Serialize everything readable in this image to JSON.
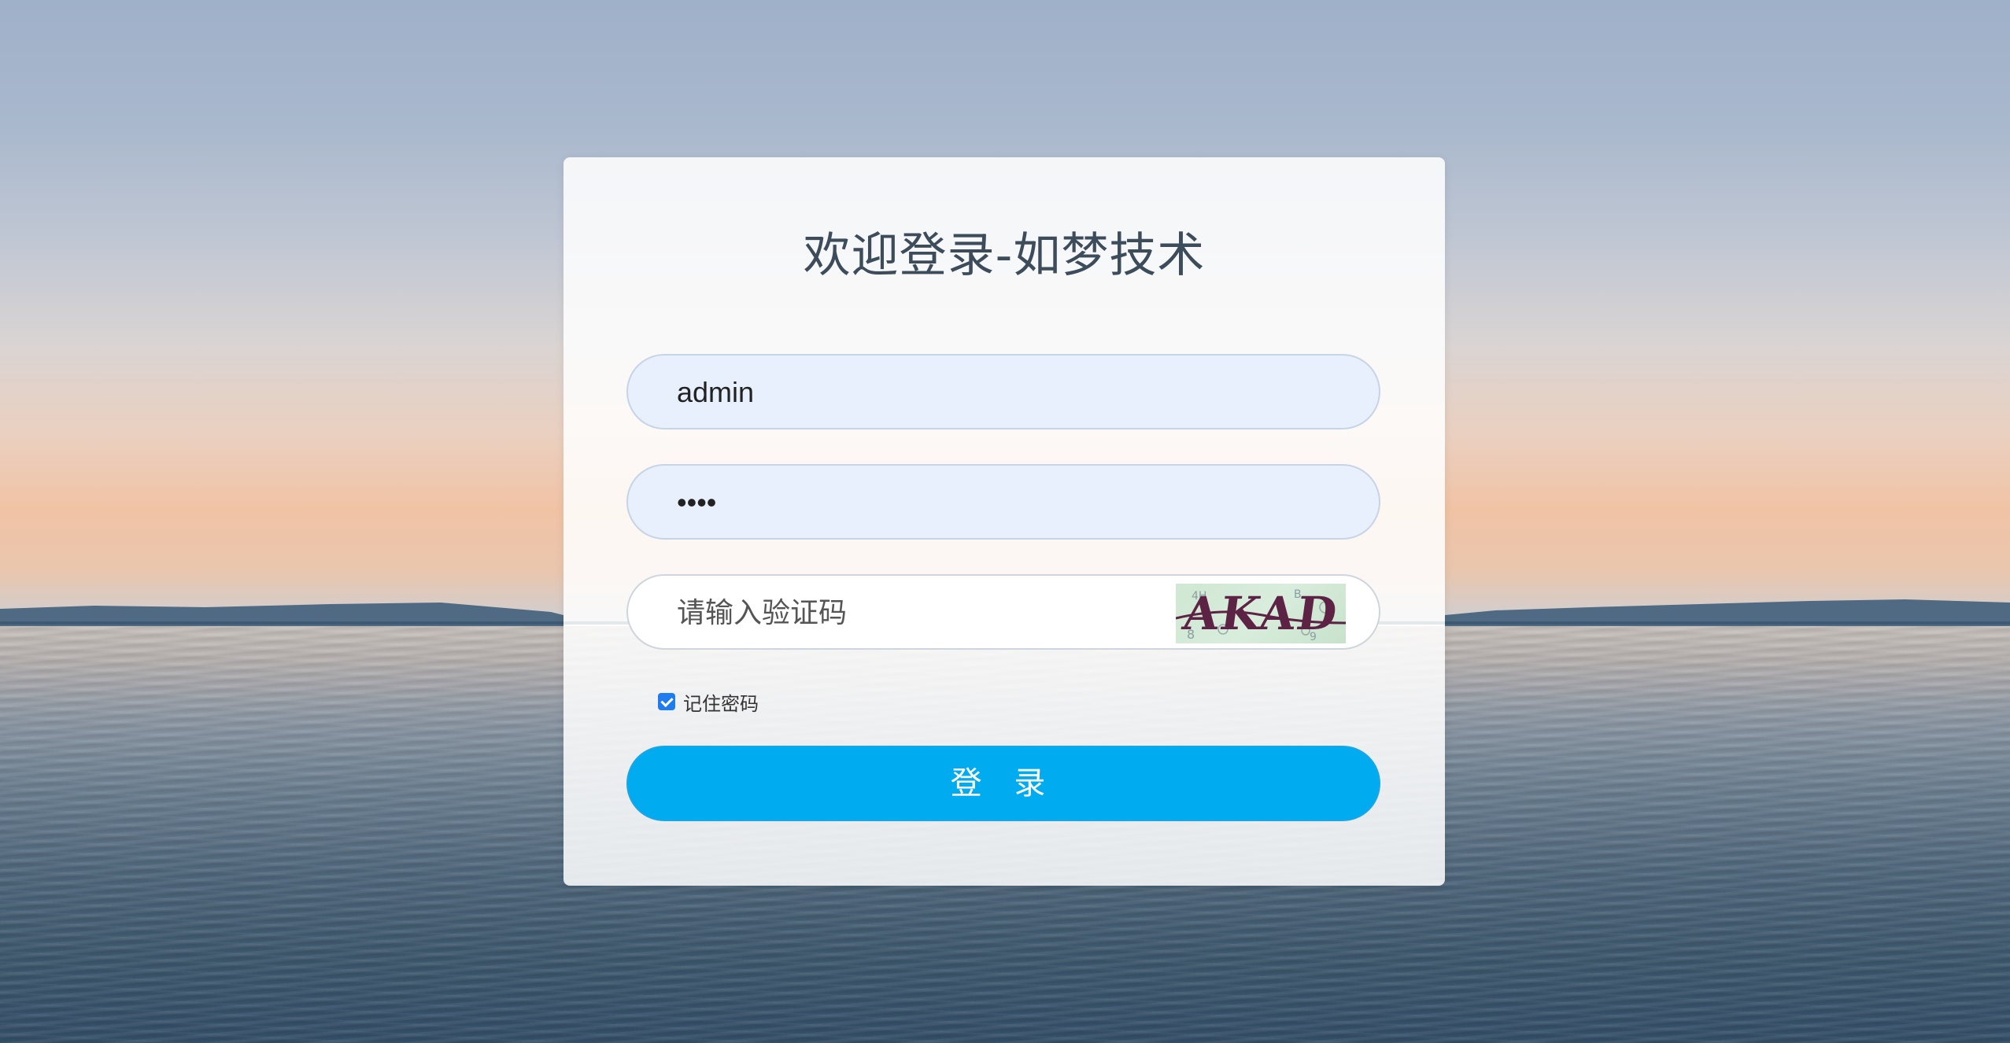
{
  "page": {
    "title": "欢迎登录-如梦技术"
  },
  "form": {
    "username_value": "admin",
    "password_value": "1234",
    "captcha_placeholder": "请输入验证码",
    "captcha_text": "AKAD",
    "remember_label": "记住密码",
    "remember_checked": true,
    "login_label": "登 录"
  },
  "colors": {
    "accent": "#00acef",
    "checkbox": "#1e7bf0",
    "title": "#3c4c5a"
  }
}
